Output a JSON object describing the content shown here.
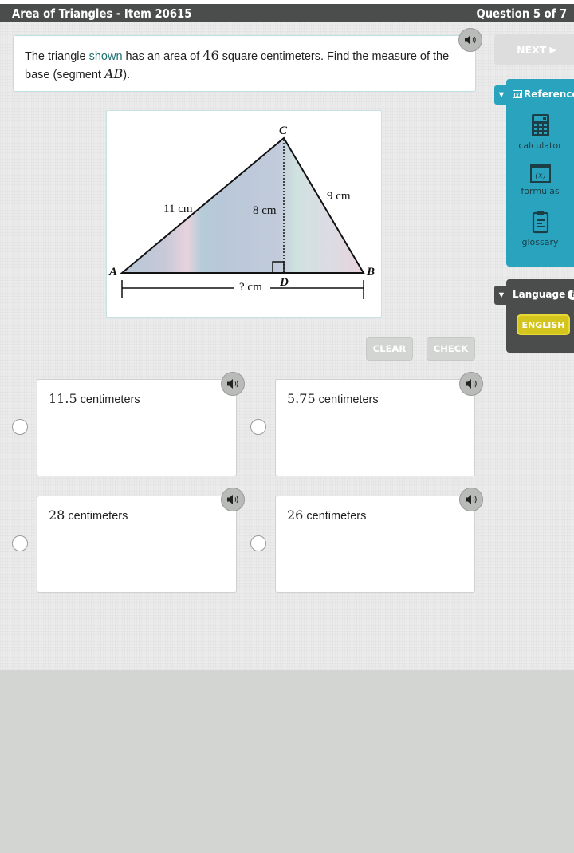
{
  "header": {
    "title": "Area of Triangles - Item 20615",
    "progress": "Question 5 of 7"
  },
  "question": {
    "text_before_link": "The triangle ",
    "link": "shown",
    "text_mid": " has an area of ",
    "area_value": "46",
    "text_after_value": " square centimeters. Find the measure of the base (segment ",
    "segment": "AB",
    "text_end": ")."
  },
  "figure": {
    "vertices": {
      "a": "A",
      "b": "B",
      "c": "C",
      "d": "D"
    },
    "labels": {
      "side_ac": "11 cm",
      "side_bc": "9 cm",
      "height_cd": "8 cm",
      "base_ab": "? cm"
    }
  },
  "nav": {
    "next_label": "NEXT",
    "next_icon": "play-triangle-icon"
  },
  "reference": {
    "title": "Reference",
    "toggle_icon": "triangle-down-icon",
    "items": [
      {
        "label": "calculator",
        "icon": "calculator-icon"
      },
      {
        "label": "formulas",
        "icon": "formulas-icon",
        "icon_text": "(x)"
      },
      {
        "label": "glossary",
        "icon": "clipboard-icon"
      }
    ]
  },
  "language": {
    "title": "Language",
    "toggle_icon": "triangle-down-icon",
    "info_glyph": "i",
    "selected": "ENGLISH"
  },
  "actions": {
    "clear_label": "CLEAR",
    "check_label": "CHECK"
  },
  "choices": [
    {
      "value": "11.5",
      "unit": " centimeters",
      "selected": false
    },
    {
      "value": "5.75",
      "unit": " centimeters",
      "selected": false
    },
    {
      "value": "28",
      "unit": " centimeters",
      "selected": false
    },
    {
      "value": "26",
      "unit": " centimeters",
      "selected": false
    }
  ],
  "colors": {
    "header_bg": "#4a4d4c",
    "reference_accent": "#2aa4be",
    "language_button": "#d4c41e",
    "link": "#1e6f6f",
    "disabled_button": "#d3d5d2"
  }
}
